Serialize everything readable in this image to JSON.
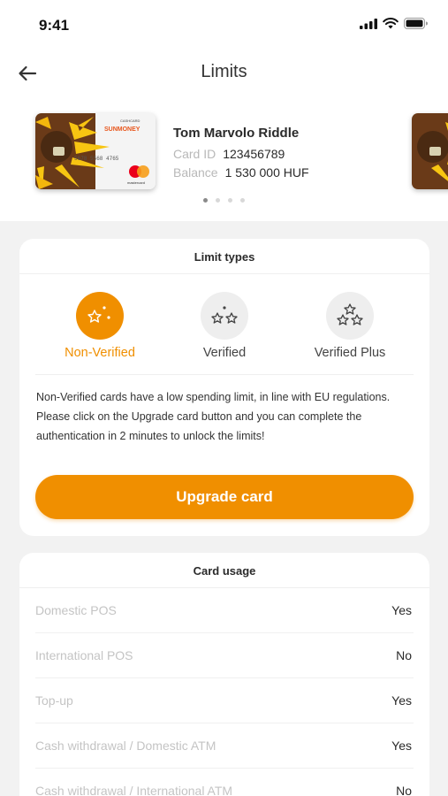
{
  "status": {
    "time": "9:41"
  },
  "header": {
    "title": "Limits"
  },
  "card": {
    "holder": "Tom Marvolo Riddle",
    "id_label": "Card ID",
    "id_value": "123456789",
    "balance_label": "Balance",
    "balance_value": "1 530 000 HUF",
    "image_brand": "SUNMONEY",
    "image_top_label": "CASHCARD",
    "image_number": "5678  5568  4765",
    "image_network": "mastercard",
    "pager_count": 4,
    "pager_active": 0
  },
  "limits": {
    "title": "Limit types",
    "tiers": [
      {
        "label": "Non-Verified",
        "icon": "one-star-icon",
        "active": true
      },
      {
        "label": "Verified",
        "icon": "two-stars-icon",
        "active": false
      },
      {
        "label": "Verified Plus",
        "icon": "three-stars-icon",
        "active": false
      }
    ],
    "description": "Non-Verified cards have a low spending limit, in line with EU regulations. Please click on the Upgrade card button and you can complete the authentication in 2 minutes to unlock the limits!",
    "button": "Upgrade card"
  },
  "usage": {
    "title": "Card usage",
    "rows": [
      {
        "label": "Domestic POS",
        "value": "Yes"
      },
      {
        "label": "International POS",
        "value": "No"
      },
      {
        "label": "Top-up",
        "value": "Yes"
      },
      {
        "label": "Cash withdrawal / Domestic ATM",
        "value": "Yes"
      },
      {
        "label": "Cash withdrawal / International ATM",
        "value": "No"
      }
    ]
  },
  "colors": {
    "accent": "#f08f00",
    "background": "#f2f2f2",
    "muted_text": "#c4c4c4"
  }
}
